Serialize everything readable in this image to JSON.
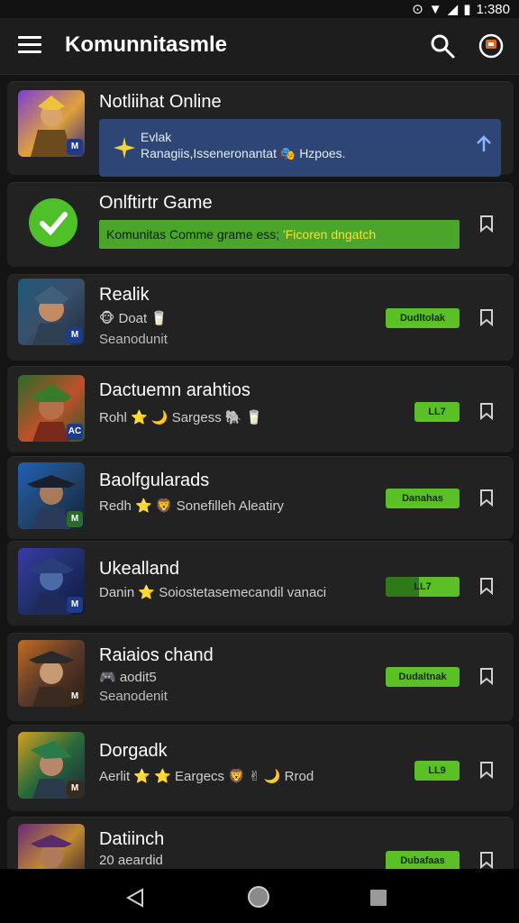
{
  "status_bar": {
    "time": "1:380"
  },
  "app_bar": {
    "title": "Komunnitasmle"
  },
  "notification_card": {
    "title": "Notliihat Online",
    "banner_title": "Evlak",
    "banner_text": "Ranagiis,Isseneronantat 🎭 Hzpoes."
  },
  "game_card": {
    "title": "Onlftirtr Game",
    "promo_text": "Komunitas Comme grame ess; ",
    "promo_highlight": "'Ficoren dngatch"
  },
  "items": [
    {
      "title": "Realik",
      "line1": "🐵 Doat 🥛",
      "line2": "Seanodunit",
      "pill": "Dudltolak",
      "badge": "M"
    },
    {
      "title": "Dactuemn arahtios",
      "line1": "Rohl ⭐ 🌙 Sargess 🐘 🥛",
      "line2": "",
      "pill": "LL7",
      "badge": "AC"
    },
    {
      "title": "Baolfgularads",
      "line1": "Redh ⭐ 🦁 Sonefilleh Aleatiry",
      "line2": "",
      "pill": "Danahas",
      "badge": "M"
    },
    {
      "title": "Ukealland",
      "line1": "Danin ⭐ Soiostetasemecandil vanaci",
      "line2": "",
      "pill": "LL7",
      "badge": "M"
    },
    {
      "title": "Raiaios chand",
      "line1": "🎮 aodit5",
      "line2": "Seanodenit",
      "pill": "Dudaltnak",
      "badge": "M"
    },
    {
      "title": "Dorgadk",
      "line1": "Aerlit ⭐ ⭐ Eargecs 🦁 ✌ 🌙 Rrod",
      "line2": "",
      "pill": "LL9",
      "badge": "M"
    },
    {
      "title": "Datiinch",
      "line1": "20 aeardid",
      "line2": "",
      "pill": "Dubafaas",
      "badge": ""
    }
  ],
  "colors": {
    "accent_green": "#5ac026",
    "banner_blue": "#2d4676",
    "card_bg": "#222223"
  }
}
